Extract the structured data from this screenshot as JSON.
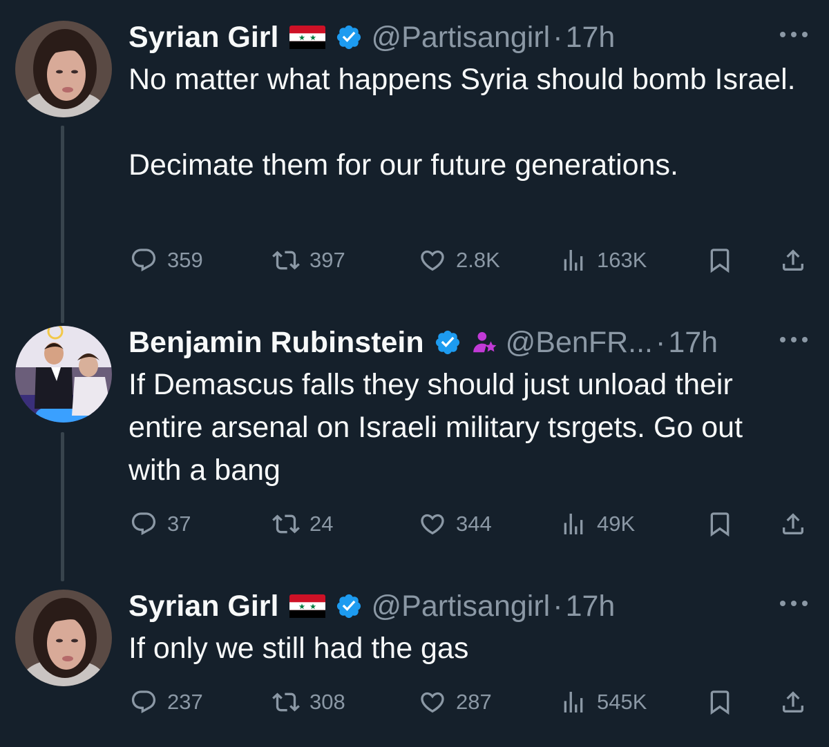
{
  "tweets": [
    {
      "name": "Syrian Girl",
      "handle": "@Partisangirl",
      "dot": "·",
      "time": "17h",
      "paragraphs": [
        "No matter what happens Syria should bomb Israel.",
        "Decimate them for our future generations."
      ],
      "replies": "359",
      "retweets": "397",
      "likes": "2.8K",
      "views": "163K"
    },
    {
      "name": "Benjamin Rubinstein",
      "handle": "@BenFR...",
      "dot": "·",
      "time": "17h",
      "paragraphs": [
        "If Demascus falls they should just unload their entire arsenal on Israeli military tsrgets. Go out with a bang"
      ],
      "replies": "37",
      "retweets": "24",
      "likes": "344",
      "views": "49K"
    },
    {
      "name": "Syrian Girl",
      "handle": "@Partisangirl",
      "dot": "·",
      "time": "17h",
      "paragraphs": [
        "If only we still had the gas"
      ],
      "replies": "237",
      "retweets": "308",
      "likes": "287",
      "views": "545K"
    }
  ],
  "icons": {
    "reply": "reply-icon",
    "retweet": "retweet-icon",
    "like": "heart-icon",
    "views": "views-icon",
    "bookmark": "bookmark-icon",
    "share": "share-icon",
    "verified": "verified-badge-icon",
    "flag": "syria-flag-icon",
    "more": "more-icon",
    "parent_badge": "parent-badge-icon"
  },
  "colors": {
    "background": "#15202b",
    "text": "#f7f9f9",
    "muted": "#8b98a5",
    "verified": "#1d9bf0",
    "thread_line": "#38444d",
    "badge_purple": "#c13ad6"
  }
}
